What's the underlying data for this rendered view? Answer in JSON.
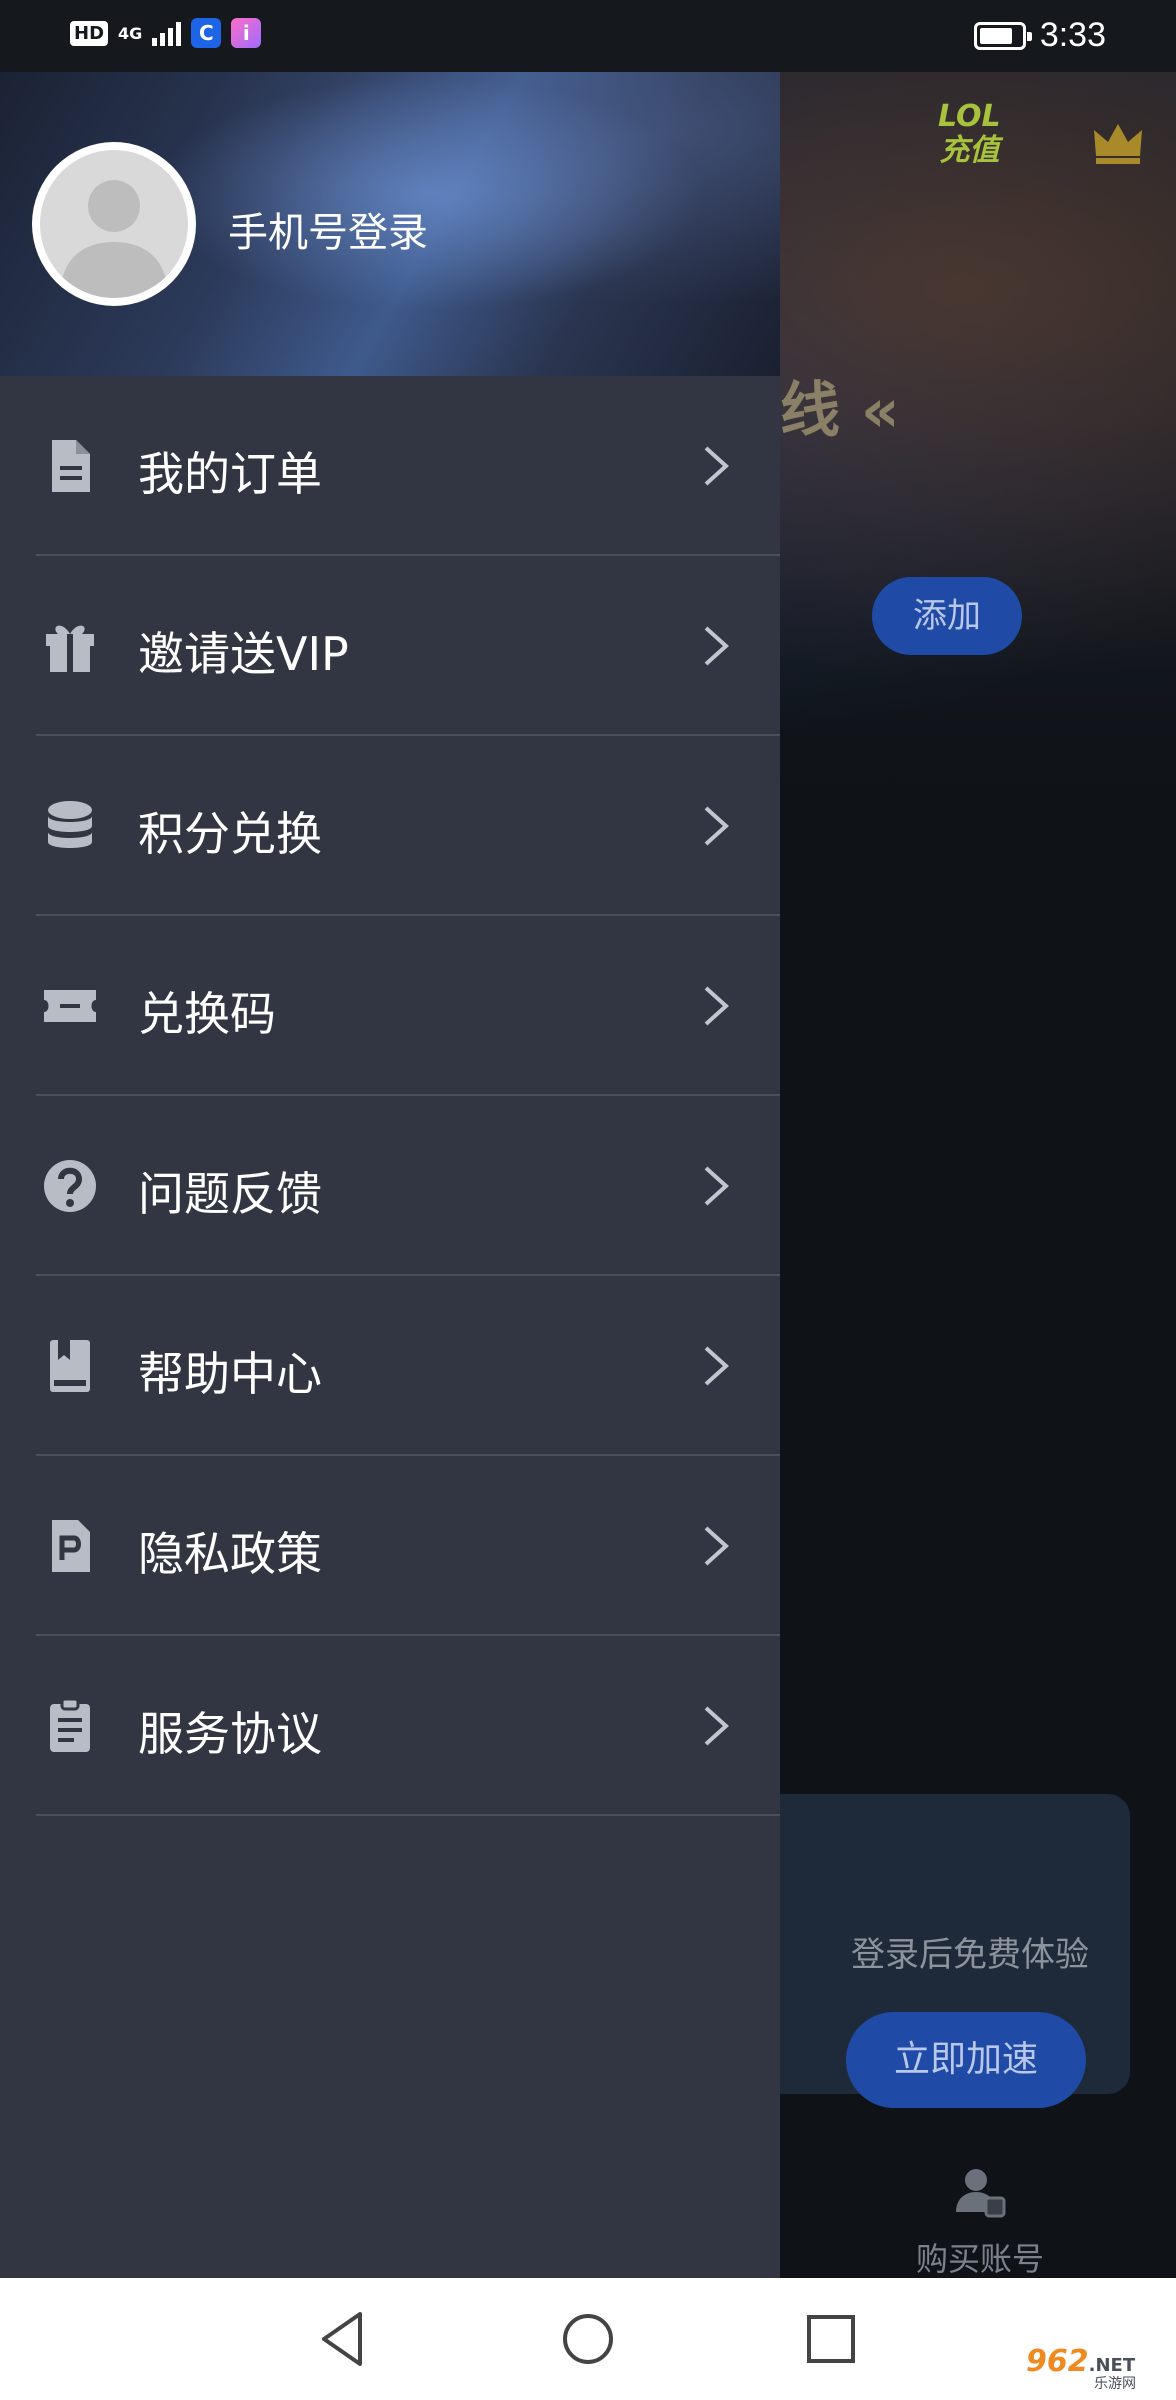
{
  "status_bar": {
    "hd": "HD",
    "network": "4G",
    "time": "3:33",
    "battery_level": 0.8
  },
  "background_app": {
    "logo": {
      "line1": "LOL",
      "line2": "充值"
    },
    "title_fragment": "线 «",
    "add_button": "添加",
    "promo_text": "登录后免费体验",
    "accelerate_button": "立即加速",
    "bottom_tab_label": "购买账号",
    "accent_color": "#1f4aa5"
  },
  "drawer": {
    "login_label": "手机号登录",
    "menu": [
      {
        "label": "我的订单",
        "icon": "document-icon"
      },
      {
        "label": "邀请送VIP",
        "icon": "gift-icon"
      },
      {
        "label": "积分兑换",
        "icon": "coins-icon"
      },
      {
        "label": "兑换码",
        "icon": "ticket-icon"
      },
      {
        "label": "问题反馈",
        "icon": "question-icon"
      },
      {
        "label": "帮助中心",
        "icon": "book-icon"
      },
      {
        "label": "隐私政策",
        "icon": "privacy-doc-icon"
      },
      {
        "label": "服务协议",
        "icon": "clipboard-icon"
      }
    ],
    "background_color": "#323643"
  },
  "watermark": {
    "main": "962",
    "net": ".NET",
    "sub": "乐游网"
  }
}
